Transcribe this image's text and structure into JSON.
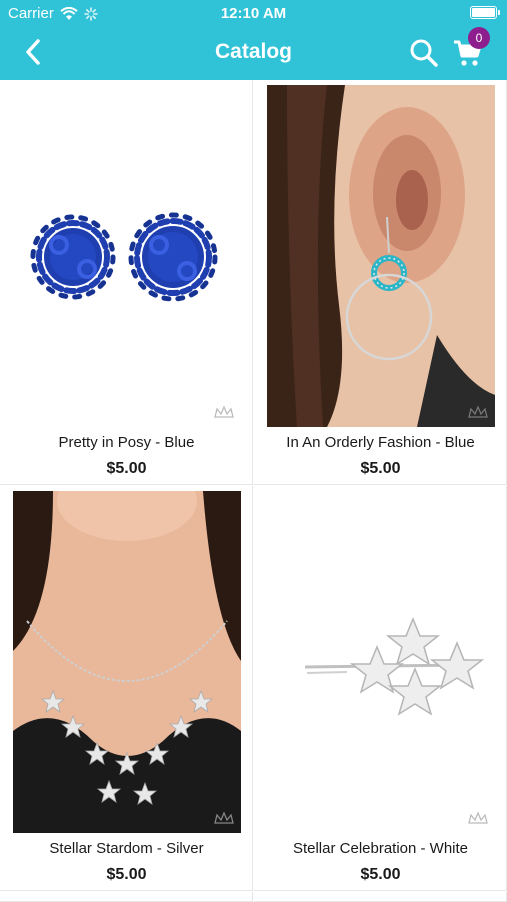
{
  "status_bar": {
    "carrier": "Carrier",
    "time": "12:10 AM"
  },
  "nav": {
    "title": "Catalog",
    "cart_count": "0"
  },
  "colors": {
    "header": "#30c2d6",
    "badge": "#8e1d8e"
  },
  "products": [
    {
      "name": "Pretty in Posy - Blue",
      "price": "$5.00"
    },
    {
      "name": "In An Orderly Fashion - Blue",
      "price": "$5.00"
    },
    {
      "name": "Stellar Stardom - Silver",
      "price": "$5.00"
    },
    {
      "name": "Stellar Celebration - White",
      "price": "$5.00"
    }
  ]
}
